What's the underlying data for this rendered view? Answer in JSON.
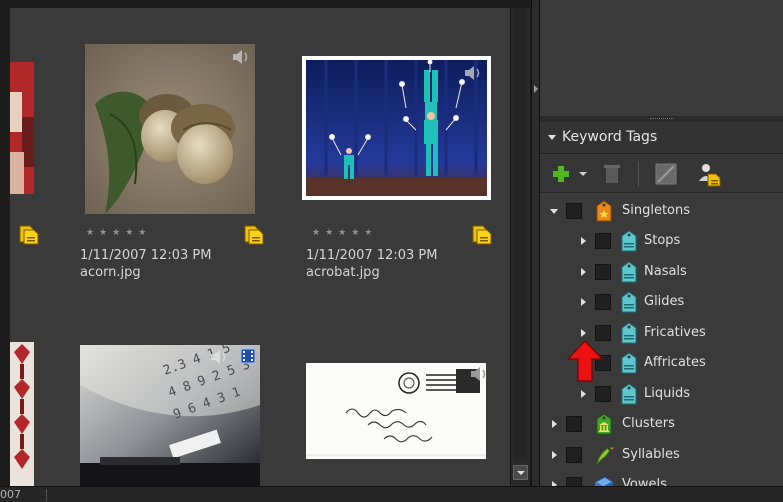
{
  "photos": [
    {
      "date": "1/11/2007 12:03 PM",
      "filename": "acorn.jpg",
      "rating_stars": "★★★★★"
    },
    {
      "date": "1/11/2007 12:03 PM",
      "filename": "acrobat.jpg",
      "rating_stars": "★★★★★"
    }
  ],
  "keyword_panel": {
    "title": "Keyword Tags",
    "toolbar": {
      "new_tag_icon": "plus-icon",
      "delete_icon": "trash-icon",
      "edit_icon": "edit-icon",
      "find_faces_icon": "people-tag-icon"
    },
    "tags": [
      {
        "label": "Singletons",
        "icon": "category-orange-tag-icon"
      },
      {
        "label": "Stops",
        "icon": "tag-icon"
      },
      {
        "label": "Nasals",
        "icon": "tag-icon"
      },
      {
        "label": "Glides",
        "icon": "tag-icon"
      },
      {
        "label": "Fricatives",
        "icon": "tag-icon"
      },
      {
        "label": "Affricates",
        "icon": "tag-icon"
      },
      {
        "label": "Liquids",
        "icon": "tag-icon"
      },
      {
        "label": "Clusters",
        "icon": "category-green-building-icon"
      },
      {
        "label": "Syllables",
        "icon": "category-bird-icon"
      },
      {
        "label": "Vowels",
        "icon": "category-blue-icon"
      }
    ]
  },
  "status_bar": {
    "text": "007"
  },
  "colors": {
    "grid_bg": "#3a3a3a",
    "panel_bg": "#3a3a3a",
    "tag_teal": "#5ec6cc",
    "singletons_orange": "#e8891c",
    "annotation_red": "#ee1111"
  }
}
